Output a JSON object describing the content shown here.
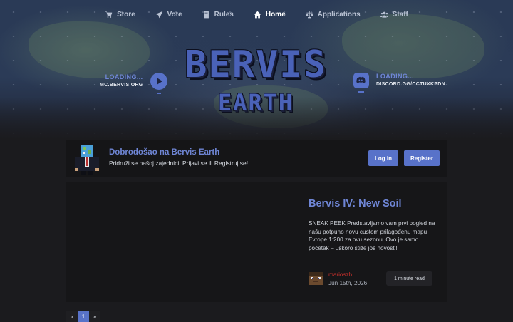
{
  "nav": [
    {
      "label": "Store",
      "icon": "cart-icon",
      "active": false
    },
    {
      "label": "Vote",
      "icon": "paper-plane-icon",
      "active": false
    },
    {
      "label": "Rules",
      "icon": "book-icon",
      "active": false
    },
    {
      "label": "Home",
      "icon": "home-icon",
      "active": true
    },
    {
      "label": "Applications",
      "icon": "scales-icon",
      "active": false
    },
    {
      "label": "Staff",
      "icon": "users-icon",
      "active": false
    }
  ],
  "logo": {
    "line1": "BERVIS",
    "line2": "EARTH"
  },
  "server": {
    "status": "LOADING...",
    "address": "MC.BERVIS.ORG"
  },
  "discord": {
    "status": "LOADING...",
    "invite": "DISCORD.GG/CCTUXKPDN"
  },
  "welcome": {
    "title": "Dobrodošao na Bervis Earth",
    "subtitle": "Pridruži se našoj zajednici, Prijavi se ili Registruj se!",
    "login_label": "Log in",
    "register_label": "Register"
  },
  "post": {
    "title": "Bervis IV: New Soil",
    "body": "SNEAK PEEK Predstavljamo vam prvi pogled na našu potpuno novu custom prilagođenu mapu Evrope 1:200 za ovu sezonu. Ovo je samo početak – uskoro stiže još novosti!",
    "author": "marioszh",
    "date": "Jun 15th, 2026",
    "read_time": "1 minute read"
  },
  "pagination": {
    "prev": "«",
    "current": "1",
    "next": "»"
  },
  "colors": {
    "accent": "#5872c9",
    "author": "#c9302c",
    "background": "#1b1b1e"
  }
}
